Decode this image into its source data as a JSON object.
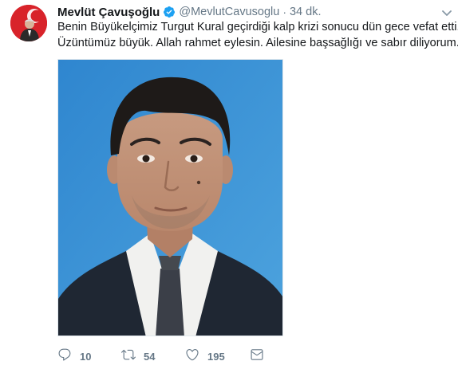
{
  "tweet": {
    "author": {
      "name": "Mevlüt Çavuşoğlu",
      "handle": "@MevlutCavusoglu",
      "verified": true
    },
    "separator": "·",
    "time": "34 dk.",
    "text_lines": [
      "Benin Büyükelçimiz Turgut Kural geçirdiği kalp krizi sonucu dün gece vefat etti.",
      "Üzüntümüz büyük. Allah rahmet eylesin. Ailesine başsağlığı ve sabır diliyorum."
    ],
    "actions": {
      "replies": "10",
      "retweets": "54",
      "likes": "195"
    }
  },
  "colors": {
    "text": "#14171a",
    "muted": "#657786",
    "verified": "#1da1f2",
    "avatar_bg": "#d8232a",
    "photo_bg": "#3a8fd0"
  },
  "icons": {
    "verified": "verified-badge-icon",
    "caret": "chevron-down-icon",
    "reply": "reply-icon",
    "retweet": "retweet-icon",
    "like": "heart-icon",
    "dm": "envelope-icon"
  }
}
